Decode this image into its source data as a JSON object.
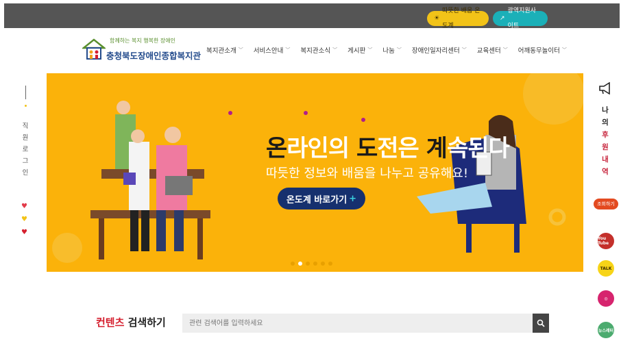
{
  "topbar": {
    "warm_label": "따뜻한 배움 온도계",
    "wide_label": "광역지원사이트"
  },
  "logo": {
    "tagline": "함께하는 복지 행복한 장애인",
    "name": "충청북도장애인종합복지관"
  },
  "nav": {
    "items": [
      {
        "label": "복지관소개"
      },
      {
        "label": "서비스안내"
      },
      {
        "label": "복지관소식"
      },
      {
        "label": "게시판"
      },
      {
        "label": "나눔"
      },
      {
        "label": "장애인일자리센터"
      },
      {
        "label": "교육센터"
      },
      {
        "label": "어깨동무놀이터"
      }
    ]
  },
  "left": {
    "login_text": "직원로그인"
  },
  "banner": {
    "title_part1": "온",
    "title_part2": "라인의 ",
    "title_part3": "도",
    "title_part4": "전은 ",
    "title_part5": "계",
    "title_part6": "속된다",
    "subtitle": "따듯한 정보와 배움을 나누고 공유해요!",
    "cta_label": "온도계 바로가기",
    "cta_plus": "+",
    "slide_count": 6,
    "active_slide": 1
  },
  "right": {
    "text_part1": "나의",
    "text_part2": "후원내역",
    "button_label": "조회하기",
    "social": [
      {
        "name": "youtube",
        "label": "You Tube",
        "color": "#c4302b"
      },
      {
        "name": "kakao",
        "label": "TALK",
        "color": "#f7d418"
      },
      {
        "name": "instagram",
        "label": "◎",
        "color": "#d6246e"
      },
      {
        "name": "news",
        "label": "뉴스레터",
        "color": "#4cab6f"
      }
    ]
  },
  "search": {
    "title_red": "컨텐츠",
    "title_rest": " 검색하기",
    "placeholder": "관련 검색어를 입력하세요"
  }
}
